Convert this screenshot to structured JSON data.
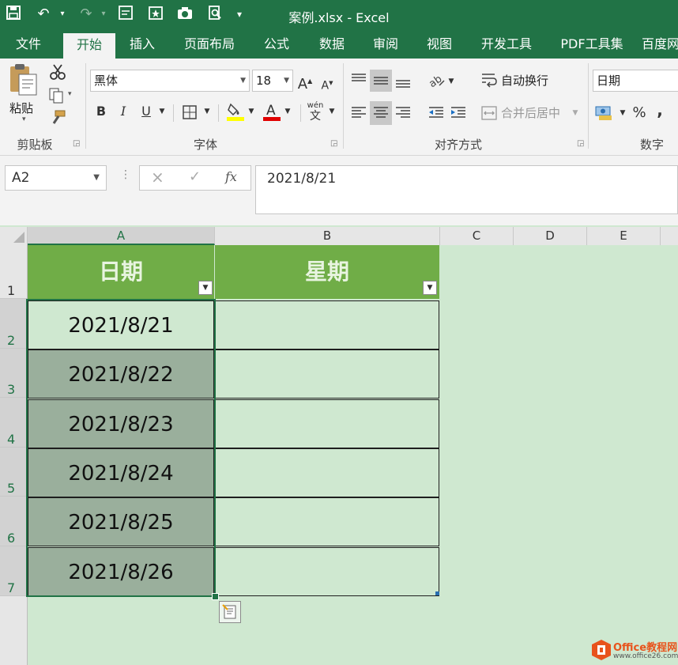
{
  "window": {
    "title": "案例.xlsx  -  Excel",
    "qat": [
      "save-icon",
      "undo-icon",
      "redo-icon",
      "form-icon",
      "star-icon",
      "camera-icon",
      "print-preview-icon",
      "customize-icon"
    ]
  },
  "tabs": [
    "文件",
    "开始",
    "插入",
    "页面布局",
    "公式",
    "数据",
    "审阅",
    "视图",
    "开发工具",
    "PDF工具集",
    "百度网"
  ],
  "active_tab": "开始",
  "ribbon": {
    "clipboard": {
      "paste_label": "粘贴",
      "group_label": "剪贴板"
    },
    "font": {
      "font_name": "黑体",
      "font_size": "18",
      "bold": "B",
      "italic": "I",
      "underline": "U",
      "phonetic_top": "wén",
      "phonetic_bottom": "文",
      "group_label": "字体"
    },
    "alignment": {
      "wrap_text": "自动换行",
      "merge_center": "合并后居中",
      "group_label": "对齐方式"
    },
    "number": {
      "format": "日期",
      "percent": "%",
      "comma": ",",
      "group_label": "数字"
    }
  },
  "formula_bar": {
    "name_box": "A2",
    "cancel": "×",
    "confirm": "✓",
    "fx": "fx",
    "formula": "2021/8/21"
  },
  "sheet": {
    "columns": [
      "A",
      "B",
      "C",
      "D",
      "E"
    ],
    "selected_column": "A",
    "rows": [
      "1",
      "2",
      "3",
      "4",
      "5",
      "6",
      "7"
    ],
    "headers": [
      "日期",
      "星期"
    ],
    "dates": [
      "2021/8/21",
      "2021/8/22",
      "2021/8/23",
      "2021/8/24",
      "2021/8/25",
      "2021/8/26"
    ],
    "weekdays": [
      "",
      "",
      "",
      "",
      "",
      ""
    ]
  },
  "watermark": {
    "line1": "Office教程网",
    "line2": "www.office26.com"
  },
  "colors": {
    "excel_green": "#217346",
    "header_fill": "#70ad47",
    "sheet_fill": "#cfe8d0",
    "selected_fill": "#9aaf9c",
    "font_color_red": "#e00000",
    "highlight_yellow": "#ffff00"
  }
}
